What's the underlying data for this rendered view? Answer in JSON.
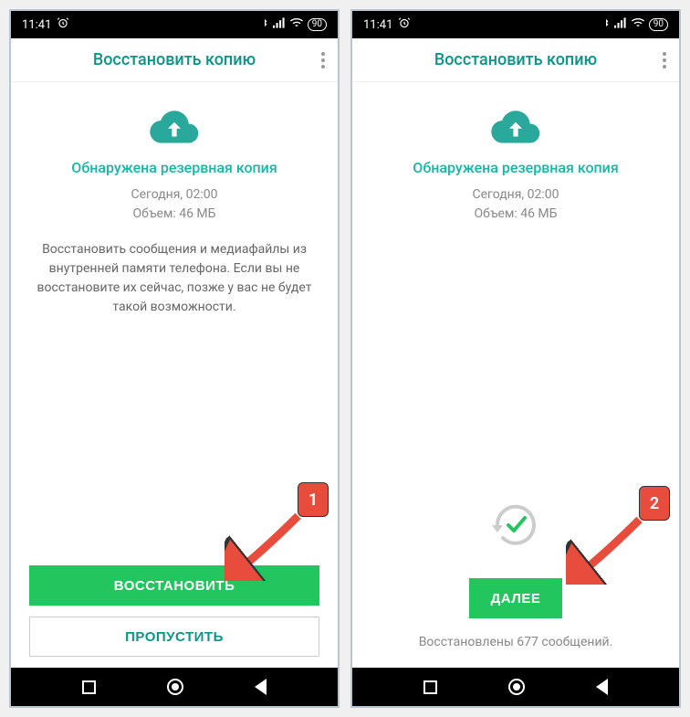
{
  "statusbar": {
    "time": "11:41",
    "battery": "90"
  },
  "appbar": {
    "title": "Восстановить копию"
  },
  "left": {
    "heading": "Обнаружена резервная копия",
    "meta_line1": "Сегодня, 02:00",
    "meta_line2": "Объем: 46 МБ",
    "body": "Восстановить сообщения и медиафайлы из внутренней памяти телефона. Если вы не восстановите их сейчас, позже у вас не будет такой возможности.",
    "btn_restore": "ВОССТАНОВИТЬ",
    "btn_skip": "ПРОПУСТИТЬ"
  },
  "right": {
    "heading": "Обнаружена резервная копия",
    "meta_line1": "Сегодня, 02:00",
    "meta_line2": "Объем: 46 МБ",
    "btn_next": "ДАЛЕЕ",
    "status": "Восстановлены 677 сообщений."
  },
  "markers": {
    "one": "1",
    "two": "2"
  }
}
